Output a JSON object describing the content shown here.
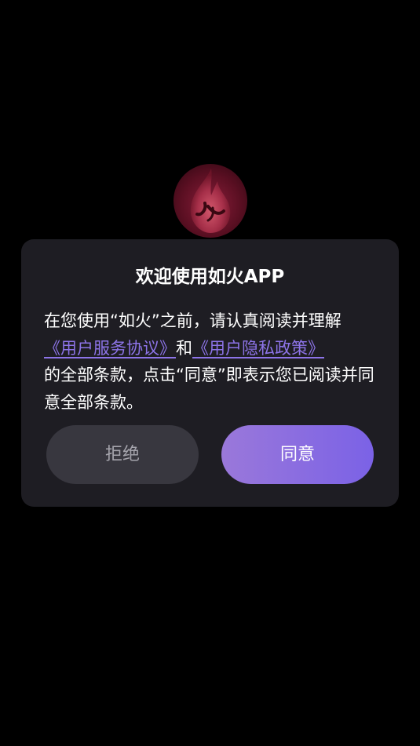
{
  "logo": {
    "icon": "flame-logo-icon"
  },
  "dialog": {
    "title": "欢迎使用如火APP",
    "body": {
      "text_before": "在您使用“如火”之前，请认真阅读并理解",
      "link_service": "《用户服务协议》",
      "text_and": "和",
      "link_privacy": "《用户隐私政策》",
      "text_after": "的全部条款，点击“同意”即表示您已阅读并同意全部条款。"
    },
    "reject_label": "拒绝",
    "agree_label": "同意"
  },
  "colors": {
    "background": "#000000",
    "dialog_background": "#1e1d23",
    "link": "#8d74e8",
    "reject_button": "#38373f",
    "agree_button_start": "#9a78da",
    "agree_button_end": "#7b62e6"
  }
}
